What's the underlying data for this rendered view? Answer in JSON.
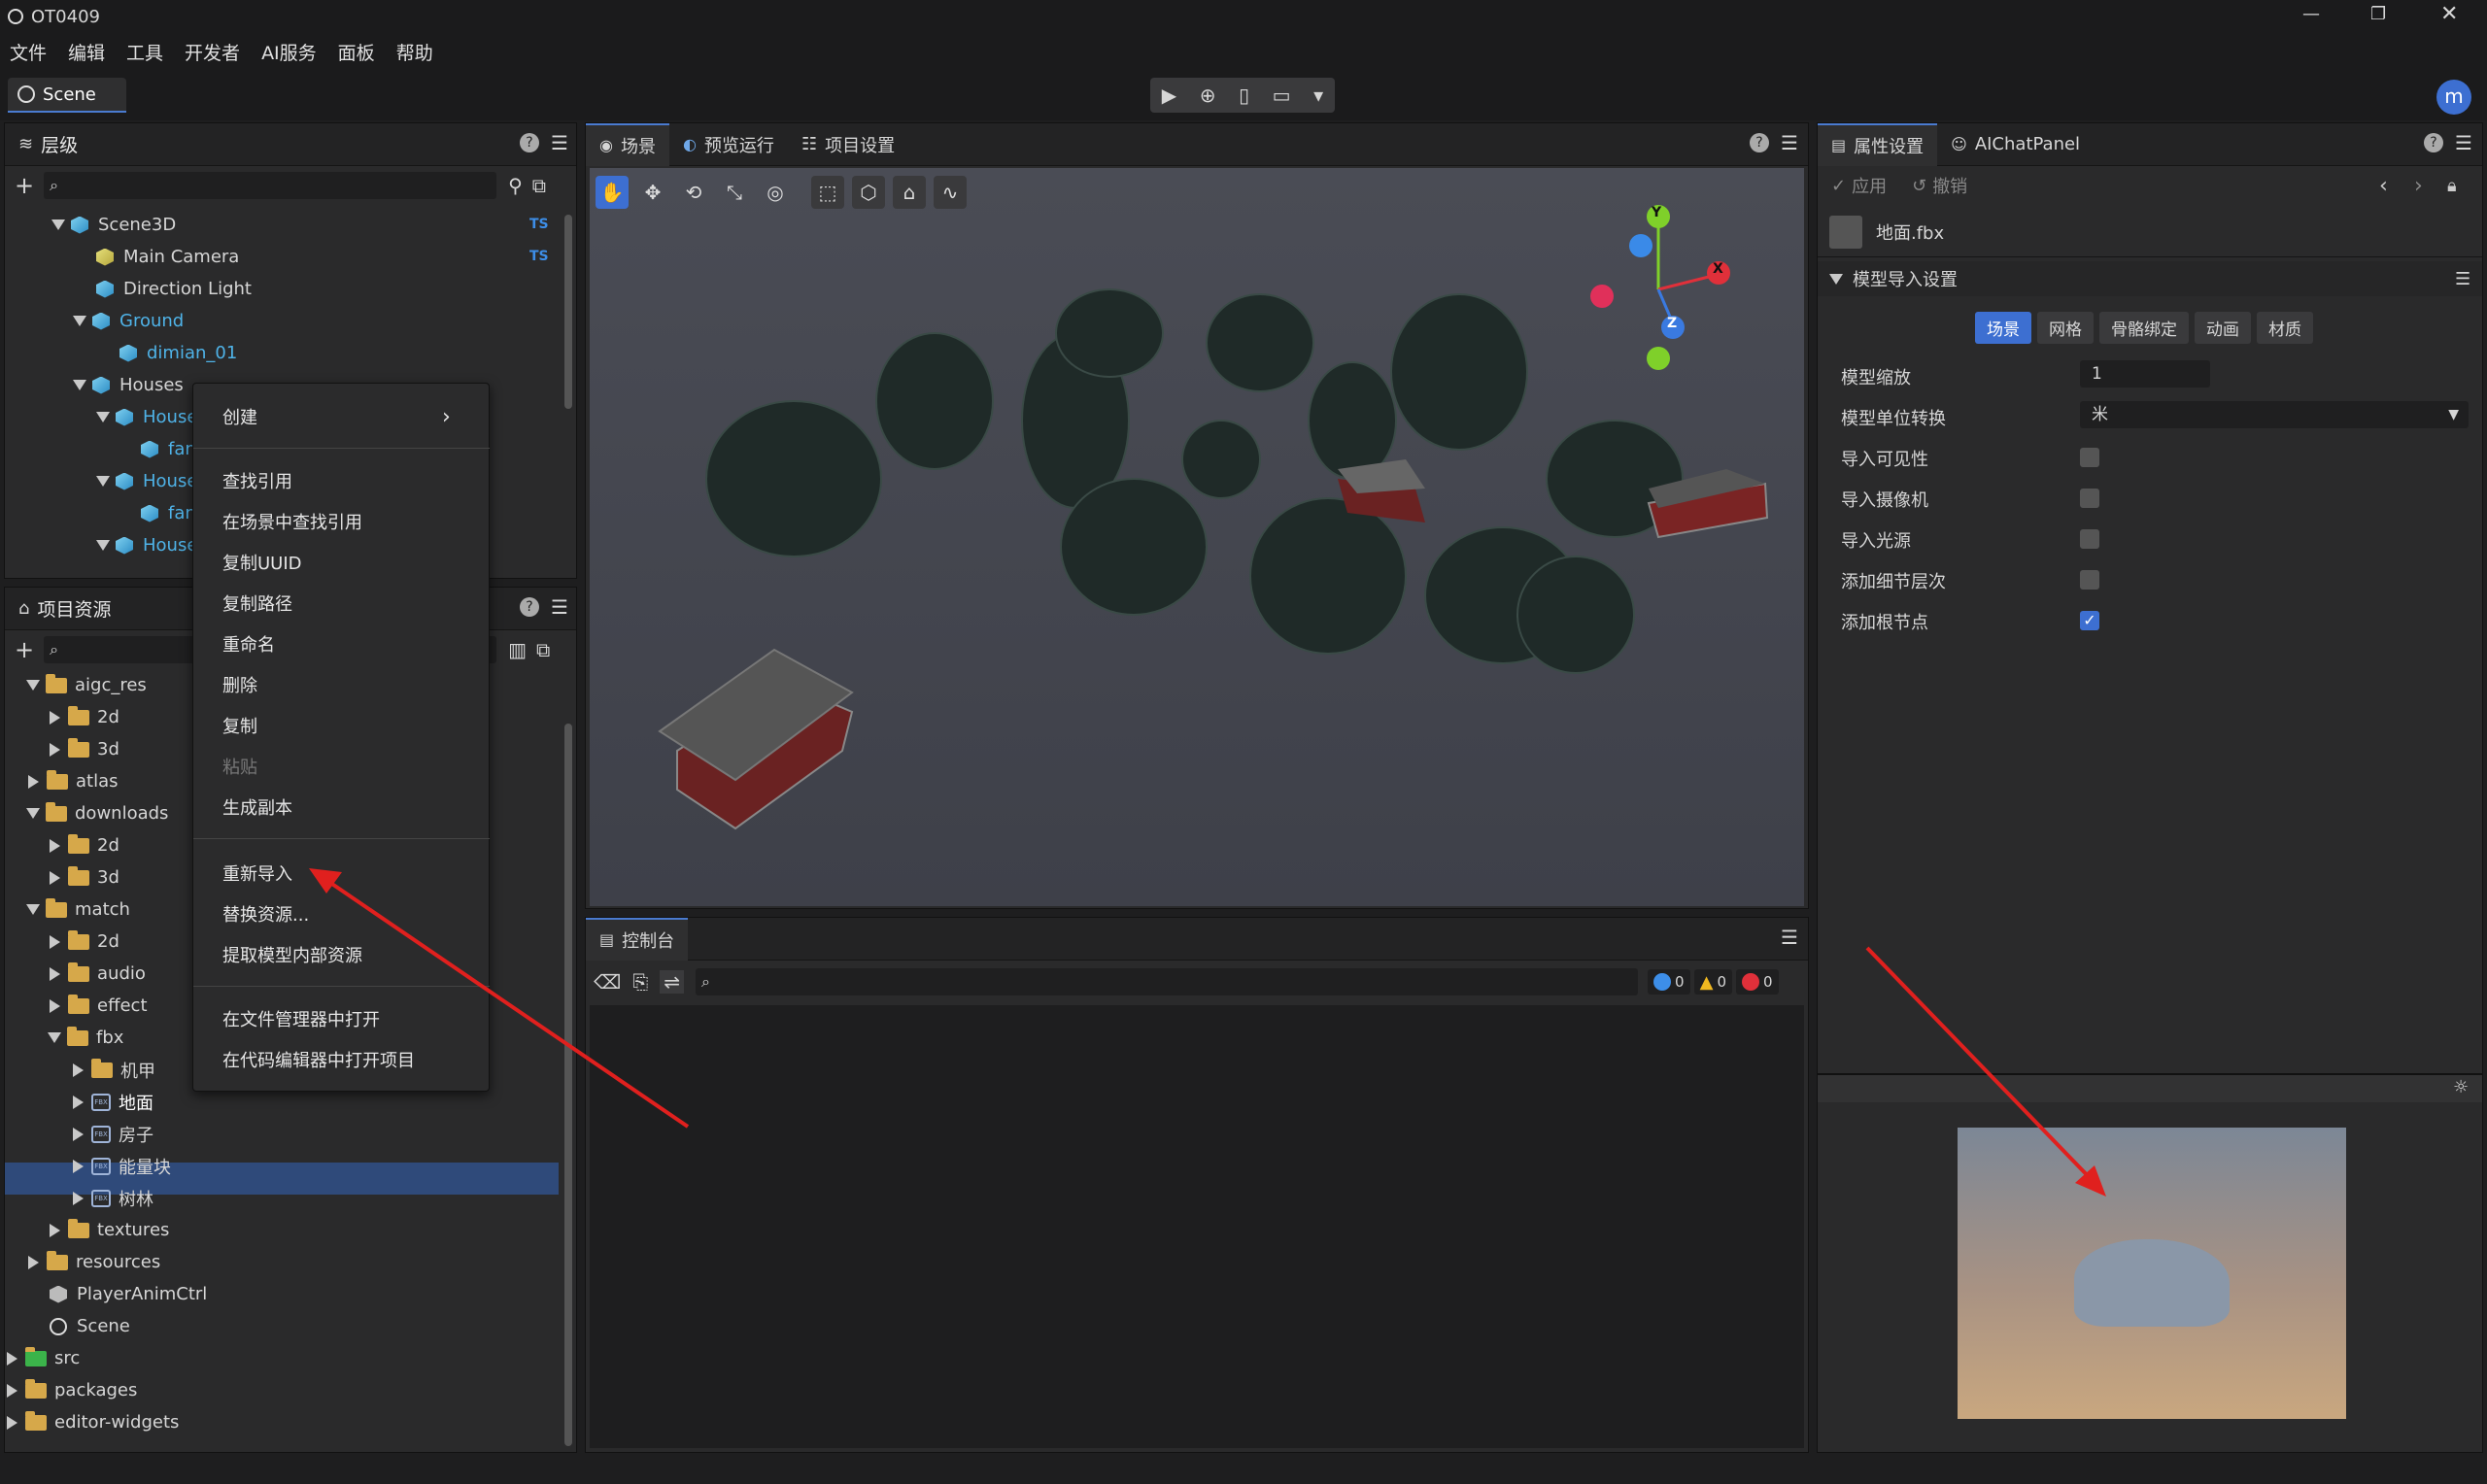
{
  "window": {
    "title": "OT0409",
    "min": "—",
    "max": "❐",
    "close": "✕"
  },
  "menu": [
    "文件",
    "编辑",
    "工具",
    "开发者",
    "AI服务",
    "面板",
    "帮助"
  ],
  "scene_tab": "Scene",
  "play_controls": [
    "▶",
    "⊕",
    "▯",
    "▭",
    "▾"
  ],
  "avatar": "m",
  "hierarchy": {
    "title": "层级",
    "items": [
      {
        "label": "Scene3D",
        "badge": "TS"
      },
      {
        "label": "Main Camera",
        "badge": "TS"
      },
      {
        "label": "Direction Light"
      },
      {
        "label": "Ground"
      },
      {
        "label": "dimian_01"
      },
      {
        "label": "Houses"
      },
      {
        "label": "House"
      },
      {
        "label": "fang"
      },
      {
        "label": "House"
      },
      {
        "label": "fang"
      },
      {
        "label": "House"
      }
    ]
  },
  "assets": {
    "title": "项目资源",
    "items": [
      "aigc_res",
      "2d",
      "3d",
      "atlas",
      "downloads",
      "2d",
      "3d",
      "match",
      "2d",
      "audio",
      "effect",
      "fbx",
      "机甲",
      "地面",
      "房子",
      "能量块",
      "树林",
      "textures",
      "resources",
      "PlayerAnimCtrl",
      "Scene",
      "src",
      "packages",
      "editor-widgets"
    ]
  },
  "context_menu": [
    "创建",
    "查找引用",
    "在场景中查找引用",
    "复制UUID",
    "复制路径",
    "重命名",
    "删除",
    "复制",
    "粘贴",
    "生成副本",
    "重新导入",
    "替换资源...",
    "提取模型内部资源",
    "在文件管理器中打开",
    "在代码编辑器中打开项目"
  ],
  "context_menu_arrow": "›",
  "center_tabs": [
    "场景",
    "预览运行",
    "项目设置"
  ],
  "console": {
    "title": "控制台",
    "counts": [
      "0",
      "0",
      "0"
    ]
  },
  "gizmo": {
    "x": "X",
    "y": "Y",
    "z": "Z"
  },
  "inspector": {
    "tabs": [
      "属性设置",
      "AIChatPanel"
    ],
    "apply": "应用",
    "revert": "撤销",
    "file": "地面.fbx",
    "section": "模型导入设置",
    "subtabs": [
      "场景",
      "网格",
      "骨骼绑定",
      "动画",
      "材质"
    ],
    "props": [
      {
        "label": "模型缩放",
        "value": "1"
      },
      {
        "label": "模型单位转换",
        "value": "米"
      },
      {
        "label": "导入可见性",
        "checked": false
      },
      {
        "label": "导入摄像机",
        "checked": false
      },
      {
        "label": "导入光源",
        "checked": false
      },
      {
        "label": "添加细节层次",
        "checked": false
      },
      {
        "label": "添加根节点",
        "checked": true
      }
    ]
  },
  "colors": {
    "accent": "#3d6fd1",
    "selected": "#2f4a7a",
    "arrow": "#e0201e"
  }
}
